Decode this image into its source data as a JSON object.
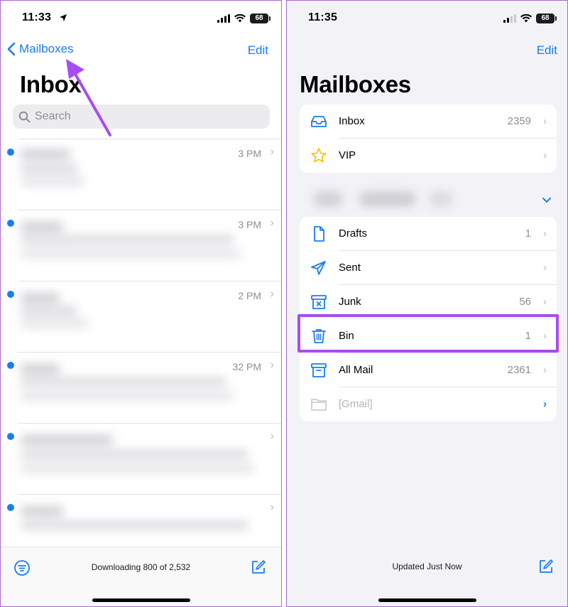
{
  "left": {
    "status": {
      "time": "11:33",
      "battery": "68"
    },
    "nav": {
      "back_label": "Mailboxes",
      "edit_label": "Edit"
    },
    "title": "Inbox",
    "search": {
      "placeholder": "Search"
    },
    "rows": [
      {
        "time": "3 PM"
      },
      {
        "time": "3 PM"
      },
      {
        "time": "2 PM"
      },
      {
        "time": "32 PM"
      },
      {
        "time": ""
      },
      {
        "time": ""
      }
    ],
    "toolbar": {
      "status_text": "Downloading 800 of 2,532"
    }
  },
  "right": {
    "status": {
      "time": "11:35",
      "battery": "68"
    },
    "nav": {
      "edit_label": "Edit"
    },
    "title": "Mailboxes",
    "favorites": [
      {
        "label": "Inbox",
        "count": "2359",
        "icon": "inbox-tray-icon"
      },
      {
        "label": "VIP",
        "count": "",
        "icon": "star-icon"
      }
    ],
    "account": [
      {
        "label": "Drafts",
        "count": "1",
        "icon": "document-icon"
      },
      {
        "label": "Sent",
        "count": "",
        "icon": "paper-plane-icon"
      },
      {
        "label": "Junk",
        "count": "56",
        "icon": "junk-box-icon"
      },
      {
        "label": "Bin",
        "count": "1",
        "icon": "trash-icon"
      },
      {
        "label": "All Mail",
        "count": "2361",
        "icon": "archive-box-icon"
      },
      {
        "label": "[Gmail]",
        "count": "",
        "icon": "folder-icon"
      }
    ],
    "toolbar": {
      "status_text": "Updated Just Now"
    }
  },
  "colors": {
    "accent": "#1a7cf0",
    "highlight": "#a94bf1",
    "annotation_arrow": "#a94bf1"
  }
}
